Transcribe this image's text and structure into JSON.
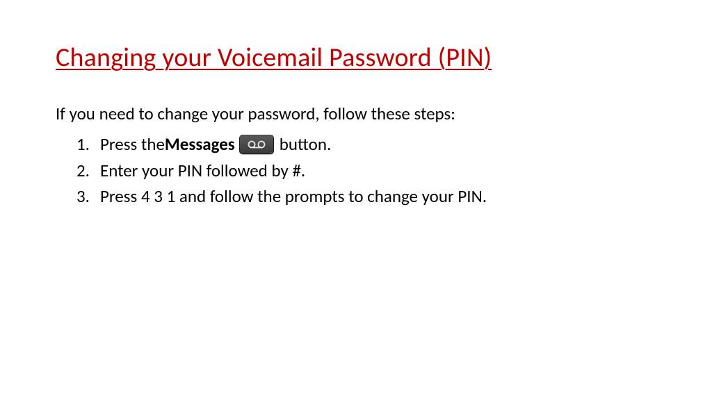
{
  "title": "Changing your Voicemail Password (PIN)",
  "intro": "If you need to change your password, follow these steps:",
  "steps": {
    "s1": {
      "num": "1.",
      "pre": "Press the ",
      "bold": "Messages",
      "post": " button."
    },
    "s2": {
      "num": "2.",
      "text": "Enter your PIN followed by #."
    },
    "s3": {
      "num": "3.",
      "text": "Press 4 3 1 and follow the prompts to change your PIN."
    }
  },
  "icon_name": "voicemail-icon"
}
